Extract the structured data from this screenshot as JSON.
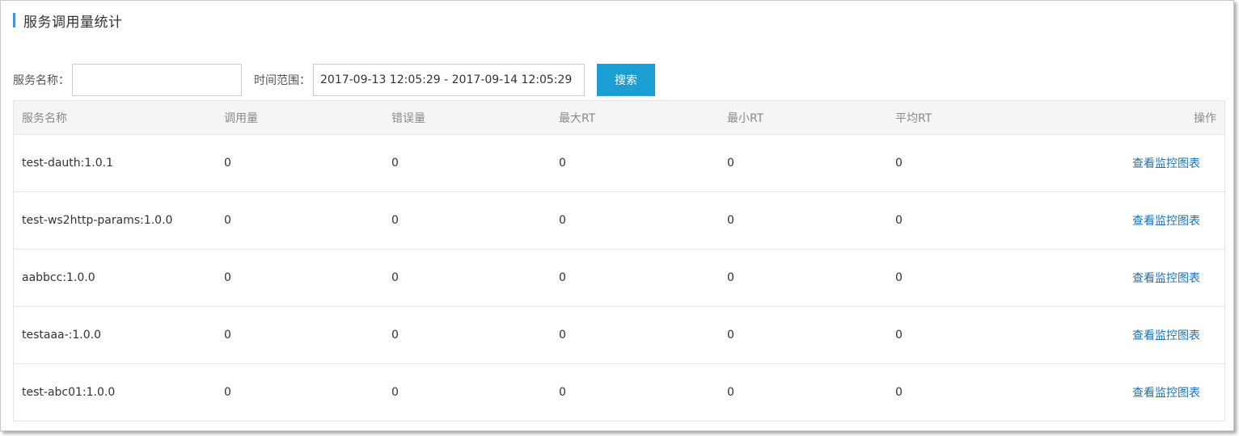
{
  "title": "服务调用量统计",
  "filters": {
    "service_label": "服务名称：",
    "service_value": "",
    "time_label": "时间范围：",
    "time_value": "2017-09-13 12:05:29 - 2017-09-14 12:05:29",
    "search_button": "搜索"
  },
  "table": {
    "headers": {
      "name": "服务名称",
      "calls": "调用量",
      "errors": "错误量",
      "max_rt": "最大RT",
      "min_rt": "最小RT",
      "avg_rt": "平均RT",
      "op": "操作"
    },
    "rows": [
      {
        "name": "test-dauth:1.0.1",
        "calls": "0",
        "errors": "0",
        "max_rt": "0",
        "min_rt": "0",
        "avg_rt": "0",
        "op": "查看监控图表"
      },
      {
        "name": "test-ws2http-params:1.0.0",
        "calls": "0",
        "errors": "0",
        "max_rt": "0",
        "min_rt": "0",
        "avg_rt": "0",
        "op": "查看监控图表"
      },
      {
        "name": "aabbcc:1.0.0",
        "calls": "0",
        "errors": "0",
        "max_rt": "0",
        "min_rt": "0",
        "avg_rt": "0",
        "op": "查看监控图表"
      },
      {
        "name": "testaaa-:1.0.0",
        "calls": "0",
        "errors": "0",
        "max_rt": "0",
        "min_rt": "0",
        "avg_rt": "0",
        "op": "查看监控图表"
      },
      {
        "name": "test-abc01:1.0.0",
        "calls": "0",
        "errors": "0",
        "max_rt": "0",
        "min_rt": "0",
        "avg_rt": "0",
        "op": "查看监控图表"
      }
    ]
  },
  "colors": {
    "accent": "#1a9ed4",
    "link": "#1a72b8",
    "title_accent": "#4a90d9"
  }
}
